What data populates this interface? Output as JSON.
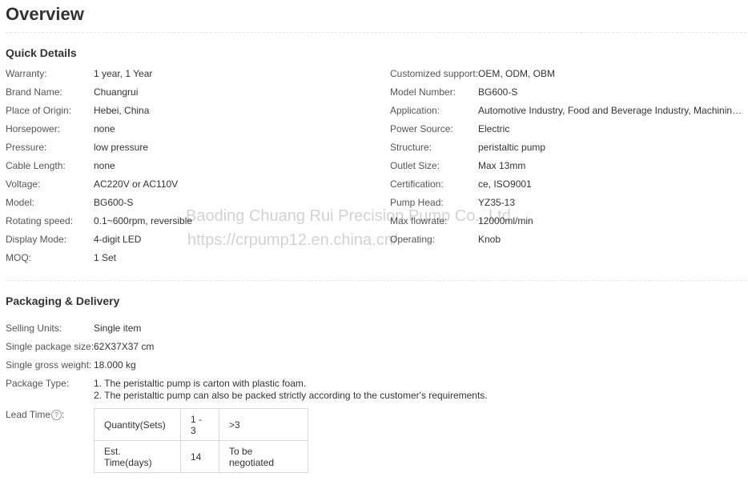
{
  "title": "Overview",
  "quick_details": {
    "heading": "Quick Details",
    "left": [
      {
        "label": "Warranty:",
        "value": "1 year, 1 Year"
      },
      {
        "label": "Brand Name:",
        "value": "Chuangrui"
      },
      {
        "label": "Place of Origin:",
        "value": "Hebei, China"
      },
      {
        "label": "Horsepower:",
        "value": "none"
      },
      {
        "label": "Pressure:",
        "value": "low pressure"
      },
      {
        "label": "Cable Length:",
        "value": "none"
      },
      {
        "label": "Voltage:",
        "value": "AC220V or AC110V"
      },
      {
        "label": "Model:",
        "value": "BG600-S"
      },
      {
        "label": "Rotating speed:",
        "value": "0.1~600rpm, reversible"
      },
      {
        "label": "Display Mode:",
        "value": "4-digit LED"
      },
      {
        "label": "MOQ:",
        "value": "1 Set"
      }
    ],
    "right": [
      {
        "label": "Customized support:",
        "value": "OEM, ODM, OBM"
      },
      {
        "label": "Model Number:",
        "value": "BG600-S"
      },
      {
        "label": "Application:",
        "value": "Automotive Industry, Food and Beverage Industry, Machining, ..."
      },
      {
        "label": "Power Source:",
        "value": "Electric"
      },
      {
        "label": "Structure:",
        "value": "peristaltic pump"
      },
      {
        "label": "Outlet Size:",
        "value": "Max 13mm"
      },
      {
        "label": "Certification:",
        "value": "ce, ISO9001"
      },
      {
        "label": "Pump Head:",
        "value": "YZ35-13"
      },
      {
        "label": "Max flowrate:",
        "value": "12000ml/min"
      },
      {
        "label": "Operating:",
        "value": "Knob"
      }
    ]
  },
  "packaging": {
    "heading": "Packaging & Delivery",
    "selling_units_label": "Selling Units:",
    "selling_units": "Single item",
    "package_size_label": "Single package size:",
    "package_size": "62X37X37 cm",
    "gross_weight_label": "Single gross weight:",
    "gross_weight": "18.000 kg",
    "package_type_label": "Package Type:",
    "package_type_line1": "1. The peristaltic pump is carton with plastic foam.",
    "package_type_line2": "2. The peristaltic pump can also be packed strictly according to the customer's requirements.",
    "lead_time_label": "Lead Time",
    "lead_time_help": "?",
    "lead_table": {
      "row1": [
        "Quantity(Sets)",
        "1 - 3",
        ">3"
      ],
      "row2": [
        "Est. Time(days)",
        "14",
        "To be negotiated"
      ]
    }
  },
  "watermark": {
    "line1": "Baoding Chuang Rui Precision Pump Co., Ltd",
    "line2": "https://crpump12.en.china.cn/"
  }
}
